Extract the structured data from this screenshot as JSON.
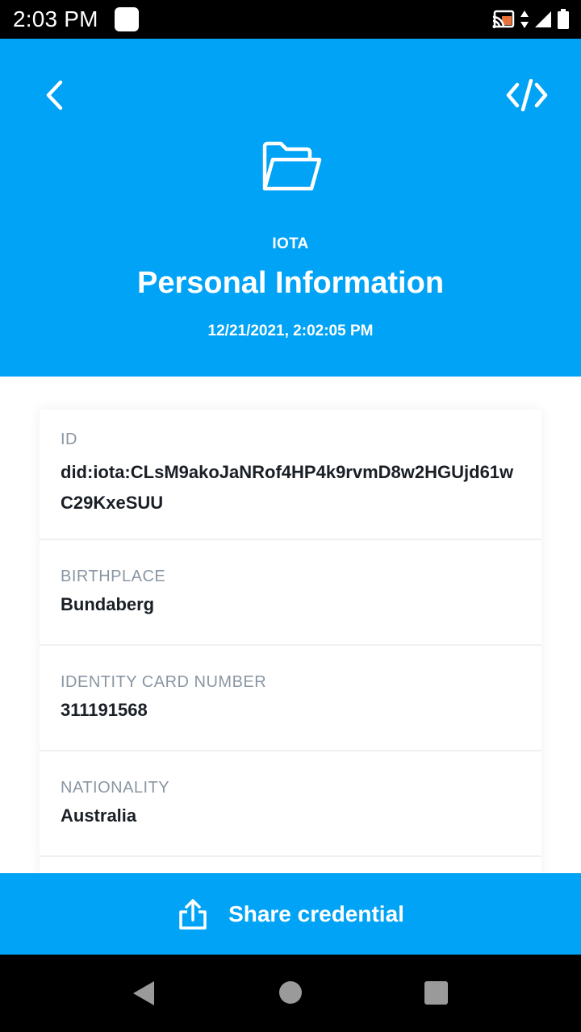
{
  "status_bar": {
    "time": "2:03 PM"
  },
  "header": {
    "issuer": "IOTA",
    "title": "Personal Information",
    "timestamp": "12/21/2021, 2:02:05 PM",
    "back_icon": "chevron-left-icon",
    "code_icon": "code-icon",
    "folder_icon": "folder-open-icon"
  },
  "fields": [
    {
      "label": "ID",
      "value": "did:iota:CLsM9akoJaNRof4HP4k9rvmD8w2HGUjd61wC29KxeSUU"
    },
    {
      "label": "BIRTHPLACE",
      "value": "Bundaberg"
    },
    {
      "label": "IDENTITY CARD NUMBER",
      "value": "311191568"
    },
    {
      "label": "NATIONALITY",
      "value": "Australia"
    }
  ],
  "share": {
    "label": "Share credential",
    "icon": "share-upload-icon"
  },
  "colors": {
    "accent": "#00a3f5",
    "label": "#8a96a3",
    "value": "#1a1f26"
  }
}
